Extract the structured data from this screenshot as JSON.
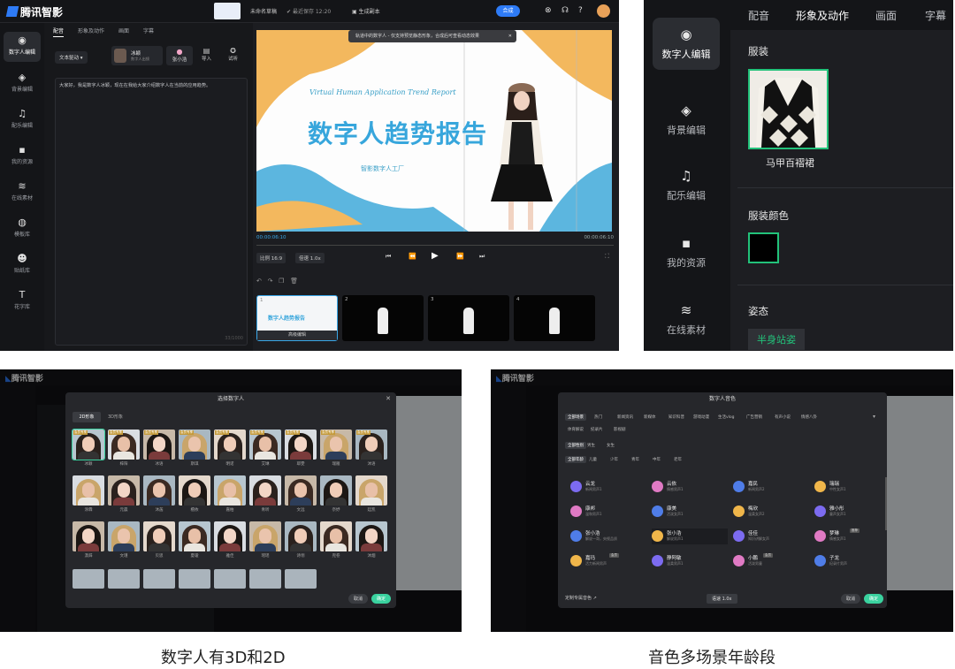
{
  "app": {
    "name": "腾讯智影"
  },
  "p1": {
    "header": {
      "draft": "未命名草稿",
      "autosave": "最近保存 12:20",
      "script": "生成副本",
      "compose": "合成"
    },
    "sidebar": [
      "数字人编辑",
      "背景编辑",
      "配乐编辑",
      "我的资源",
      "在线素材",
      "模板库",
      "贴纸库",
      "花字库"
    ],
    "tabs": [
      "配音",
      "形象及动作",
      "画面",
      "字幕"
    ],
    "driver": "文本驱动",
    "voice": {
      "name": "冰颖",
      "desc": "数字人出镜"
    },
    "actions": [
      "张小浩",
      "导入",
      "试听"
    ],
    "script_text": "大家好，我是数字人冰颖，现在在我给大家介绍数字人在当前的应用趋势。",
    "counter": "33/1000",
    "toast": "轨道中的数字人 - 仅支持预览静态形象，合成后可查看动态效果",
    "slide": {
      "en": "Virtual Human Application Trend Report",
      "zh": "数字人趋势报告",
      "sub": "智影数字人工厂"
    },
    "time_left": "00:00:06:10",
    "time_right": "00:00:06:10",
    "ratio": "比例 16:9",
    "speed": "倍速 1.0x",
    "thumb_caption": "高级编辑",
    "thumb_nums": [
      "1",
      "2",
      "3",
      "4"
    ]
  },
  "p2": {
    "sidebar": [
      "数字人编辑",
      "背景编辑",
      "配乐编辑",
      "我的资源",
      "在线素材"
    ],
    "tabs": [
      "配音",
      "形象及动作",
      "画面",
      "字幕"
    ],
    "section_outfit": "服装",
    "outfit_name": "马甲百褶裙",
    "section_color": "服装颜色",
    "section_pose": "姿态",
    "pose_value": "半身站姿"
  },
  "p3": {
    "title": "选择数字人",
    "tabs": [
      "2D形象",
      "3D形象"
    ],
    "badge": "会员专享",
    "names": [
      [
        "冰颖",
        "梓阳",
        "冰语",
        "斯琪",
        "明诺",
        "艾琳",
        "耶雯",
        "瑞雁",
        "沐语"
      ],
      [
        "涂霖",
        "元晨",
        "沐菡",
        "檀依",
        "嘉柏",
        "青听",
        "文远",
        "奈妤",
        "廷凯"
      ],
      [
        "漠辞",
        "文瑾",
        "贝思",
        "夏瑷",
        "雅佳",
        "瑶瑶",
        "诗翎",
        "兜卷",
        "沐烟"
      ]
    ],
    "cancel": "取消",
    "confirm": "确定"
  },
  "p4": {
    "title": "数字人音色",
    "cats": [
      "全部场景",
      "热门",
      "新闻资讯",
      "新媒体",
      "知识科普",
      "游戏动漫",
      "生活vlog",
      "广告营销",
      "有声小说",
      "情感八卦"
    ],
    "cats2": [
      "体育解说",
      "纪录片",
      "影视剧"
    ],
    "genders": [
      "全部性别",
      "男生",
      "女生"
    ],
    "ages": [
      "全部年龄",
      "儿童",
      "少年",
      "青年",
      "中年",
      "老年"
    ],
    "voices": [
      {
        "name": "云龙",
        "desc": "新闻男声1"
      },
      {
        "name": "云依",
        "desc": "情感男声1"
      },
      {
        "name": "嘉民",
        "desc": "新闻男声2"
      },
      {
        "name": "瑞瑞",
        "desc": "中性女声1"
      },
      {
        "name": "康邦",
        "desc": "温和男声1"
      },
      {
        "name": "康美",
        "desc": "活泼女声1"
      },
      {
        "name": "梅欣",
        "desc": "温柔女声2"
      },
      {
        "name": "雅小彤",
        "desc": "童声女声1"
      },
      {
        "name": "张小浩",
        "desc": "解说一哥，央视品质"
      },
      {
        "name": "张小浩",
        "desc": "解说男声1"
      },
      {
        "name": "佳佳",
        "desc": "知识讲解女声"
      },
      {
        "name": "梦琳",
        "desc": "情感女声1"
      },
      {
        "name": "嘉玛",
        "desc": "活力新闻男声"
      },
      {
        "name": "静阿敏",
        "desc": "温柔男声1"
      },
      {
        "name": "小鹏",
        "desc": "活泼男童"
      },
      {
        "name": "子龙",
        "desc": "纪录片男声"
      }
    ],
    "tags": [
      "推荐",
      "会员",
      "会员"
    ],
    "footer_link": "定制专属音色",
    "speed": "语速 1.0x",
    "cancel": "取消",
    "confirm": "确定"
  },
  "captions": {
    "left": "数字人有3D和2D",
    "right": "音色多场景年龄段"
  },
  "colors": {
    "accent": "#2e7bf6",
    "green": "#22c27a",
    "confirm": "#3ad29f",
    "slide_blue": "#37a6dc"
  }
}
